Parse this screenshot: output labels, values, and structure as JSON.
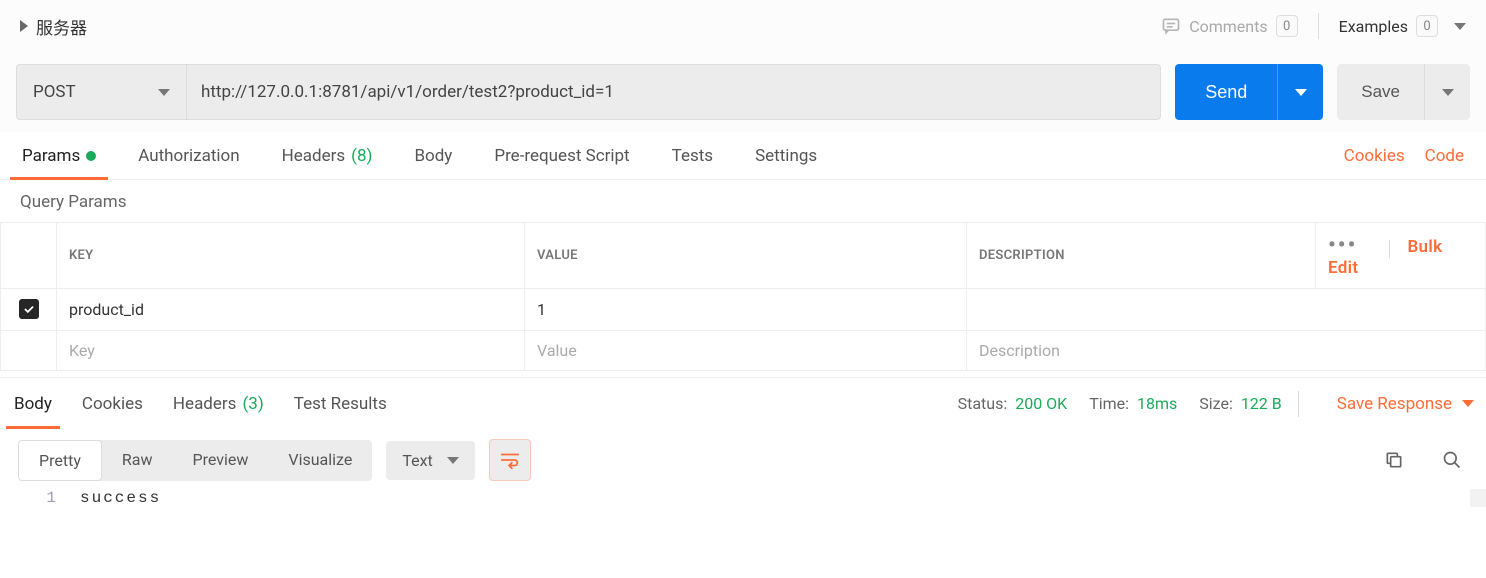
{
  "header": {
    "tab_title": "服务器",
    "comments_label": "Comments",
    "comments_count": "0",
    "examples_label": "Examples",
    "examples_count": "0"
  },
  "request": {
    "method": "POST",
    "url": "http://127.0.0.1:8781/api/v1/order/test2?product_id=1",
    "send_label": "Send",
    "save_label": "Save"
  },
  "req_tabs": {
    "params": "Params",
    "authorization": "Authorization",
    "headers": "Headers",
    "headers_count": "(8)",
    "body": "Body",
    "pre_request": "Pre-request Script",
    "tests": "Tests",
    "settings": "Settings",
    "cookies": "Cookies",
    "code": "Code"
  },
  "query_params": {
    "title": "Query Params",
    "header_key": "KEY",
    "header_value": "VALUE",
    "header_description": "DESCRIPTION",
    "bulk_edit": "Bulk Edit",
    "rows": [
      {
        "key": "product_id",
        "value": "1",
        "description": ""
      }
    ],
    "placeholder_key": "Key",
    "placeholder_value": "Value",
    "placeholder_description": "Description"
  },
  "resp_tabs": {
    "body": "Body",
    "cookies": "Cookies",
    "headers": "Headers",
    "headers_count": "(3)",
    "test_results": "Test Results",
    "status_label": "Status:",
    "status_value": "200 OK",
    "time_label": "Time:",
    "time_value": "18ms",
    "size_label": "Size:",
    "size_value": "122 B",
    "save_response": "Save Response"
  },
  "format_bar": {
    "pretty": "Pretty",
    "raw": "Raw",
    "preview": "Preview",
    "visualize": "Visualize",
    "content_type": "Text"
  },
  "response_body": {
    "line_number": "1",
    "content": "success"
  }
}
